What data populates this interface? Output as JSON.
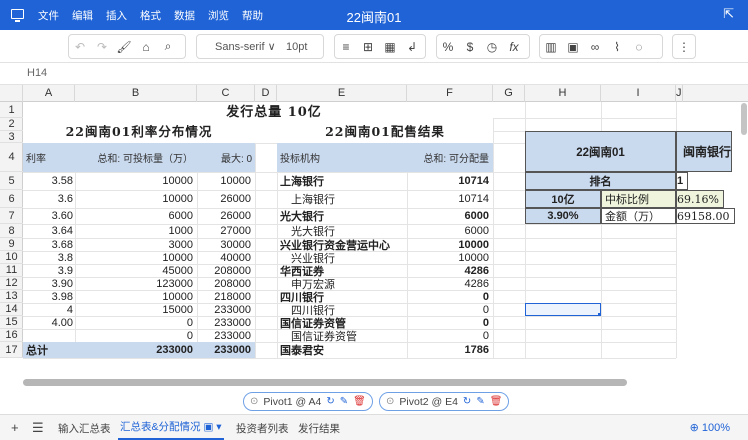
{
  "window": {
    "title": "22闽南01"
  },
  "menu": [
    "文件",
    "编辑",
    "插入",
    "格式",
    "数据",
    "浏览",
    "帮助"
  ],
  "toolbar": {
    "font_family": "Sans-serif",
    "font_family_caret": "∨",
    "font_size": "10pt"
  },
  "formula_bar": {
    "cell_ref": "H14"
  },
  "columns": [
    "A",
    "B",
    "C",
    "D",
    "E",
    "F",
    "G",
    "H",
    "I",
    "J"
  ],
  "rows": [
    "1",
    "2",
    "3",
    "4",
    "5",
    "6",
    "7",
    "8",
    "9",
    "10",
    "11",
    "12",
    "13",
    "14",
    "15",
    "16",
    "17"
  ],
  "pivot1": {
    "title_main": "发行总量 10亿",
    "title": "22闽南01利率分布情况",
    "headers": [
      "利率",
      "总和: 可投标量（万）",
      "最大: 0"
    ],
    "rows": [
      [
        "3.58",
        "10000",
        "10000"
      ],
      [
        "3.6",
        "10000",
        "26000"
      ],
      [
        "3.60",
        "6000",
        "26000"
      ],
      [
        "3.64",
        "1000",
        "27000"
      ],
      [
        "3.68",
        "3000",
        "30000"
      ],
      [
        "3.8",
        "10000",
        "40000"
      ],
      [
        "3.9",
        "45000",
        "208000"
      ],
      [
        "3.90",
        "123000",
        "208000"
      ],
      [
        "3.98",
        "10000",
        "218000"
      ],
      [
        "4",
        "15000",
        "233000"
      ],
      [
        "4.00",
        "0",
        "233000"
      ],
      [
        "",
        "0",
        "233000"
      ]
    ],
    "total": [
      "总计",
      "233000",
      "233000"
    ]
  },
  "pivot2": {
    "title": "22闽南01配售结果",
    "headers": [
      "投标机构",
      "总和: 可分配量"
    ],
    "rows": [
      [
        "上海银行",
        "10714"
      ],
      [
        "上海银行",
        "10714"
      ],
      [
        "光大银行",
        "6000"
      ],
      [
        "光大银行",
        "6000"
      ],
      [
        "兴业银行资金营运中心",
        "10000"
      ],
      [
        "兴业银行",
        "10000"
      ],
      [
        "华西证券",
        "4286"
      ],
      [
        "申万宏源",
        "4286"
      ],
      [
        "四川银行",
        "0"
      ],
      [
        "四川银行",
        "0"
      ],
      [
        "国信证券资管",
        "0"
      ],
      [
        "国信证券资管",
        "0"
      ],
      [
        "国泰君安",
        "1786"
      ]
    ]
  },
  "summary": {
    "h_title": "22闽南01",
    "j_title": "闽南银行",
    "rank_label": "排名",
    "rank_value": "1",
    "amount": "10亿",
    "ratio_label": "中标比例",
    "ratio_value": "69.16%",
    "rate": "3.90%",
    "money_label": "金额（万）",
    "money_value": "69158.00"
  },
  "pivot_chips": [
    {
      "label": "Pivot1 @ A4"
    },
    {
      "label": "Pivot2 @ E4"
    }
  ],
  "sheet_tabs": [
    "输入汇总表",
    "汇总表&分配情况",
    "投资者列表",
    "发行结果"
  ],
  "zoom": "100%",
  "colors": {
    "accent": "#1f63d6",
    "pivot_header": "#c9d9ee",
    "summary_fill": "#c9d9ee",
    "ratio_fill": "#eef5dc"
  }
}
